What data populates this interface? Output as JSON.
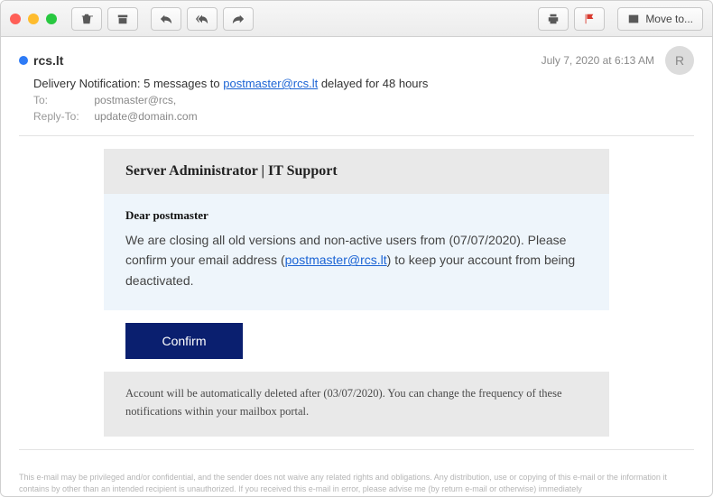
{
  "toolbar": {
    "move_to": "Move to..."
  },
  "header": {
    "sender": "rcs.lt",
    "date": "July 7, 2020 at 6:13 AM",
    "avatar_initial": "R",
    "subject_prefix": "Delivery Notification: 5 messages to ",
    "subject_link": "postmaster@rcs.lt",
    "subject_suffix": " delayed for 48 hours",
    "to_label": "To:",
    "to_value": "postmaster@rcs,",
    "replyto_label": "Reply-To:",
    "replyto_value": "update@domain.com"
  },
  "email": {
    "card_title": "Server Administrator | IT Support",
    "greeting": "Dear postmaster",
    "body_part1": "We are closing all old versions and non-active users from (07/07/2020). Please confirm your email address (",
    "body_link": "postmaster@rcs.lt",
    "body_part2": ") to keep your account from being deactivated.",
    "confirm_label": "Confirm",
    "footer_note": "Account will be  automatically deleted after (03/07/2020). You can change the frequency of these notifications within your mailbox portal."
  },
  "disclaimer": "This e-mail may be privileged and/or confidential, and the sender does not waive any related rights and obligations. Any distribution, use or copying of this e-mail or the information it contains by other than an intended recipient is unauthorized. If you received this e-mail in error, please advise me (by return e-mail or otherwise) immediately"
}
